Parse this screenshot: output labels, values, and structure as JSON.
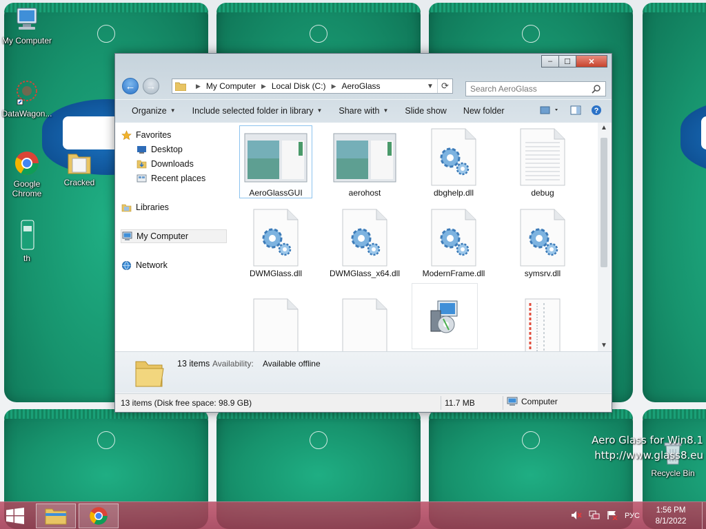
{
  "desktop": {
    "icons": [
      {
        "label": "My Computer"
      },
      {
        "label": "DataWagon..."
      },
      {
        "label": "Google Chrome"
      },
      {
        "label": "Cracked"
      },
      {
        "label": "th"
      },
      {
        "label": "Recycle Bin"
      }
    ],
    "watermark": {
      "line1": "Aero Glass for Win8.1",
      "line2": "http://www.glass8.eu"
    }
  },
  "window": {
    "address": {
      "crumbs": [
        "My Computer",
        "Local Disk (C:)",
        "AeroGlass"
      ]
    },
    "search": {
      "placeholder": "Search AeroGlass"
    },
    "commands": {
      "organize": "Organize",
      "include": "Include selected folder in library",
      "share": "Share with",
      "slideshow": "Slide show",
      "newfolder": "New folder"
    },
    "nav": {
      "favorites": "Favorites",
      "desktop": "Desktop",
      "downloads": "Downloads",
      "recent": "Recent places",
      "libraries": "Libraries",
      "computer": "My Computer",
      "network": "Network"
    },
    "files": [
      {
        "name": "AeroGlassGUI",
        "kind": "app-window"
      },
      {
        "name": "aerohost",
        "kind": "app-window"
      },
      {
        "name": "dbghelp.dll",
        "kind": "gear-doc"
      },
      {
        "name": "debug",
        "kind": "text-doc"
      },
      {
        "name": "DWMGlass.dll",
        "kind": "gear-doc"
      },
      {
        "name": "DWMGlass_x64.dll",
        "kind": "gear-doc"
      },
      {
        "name": "ModernFrame.dll",
        "kind": "gear-doc"
      },
      {
        "name": "symsrv.dll",
        "kind": "gear-doc"
      },
      {
        "name": "",
        "kind": "blank-doc"
      },
      {
        "name": "",
        "kind": "blank-doc"
      },
      {
        "name": "",
        "kind": "installer"
      },
      {
        "name": "",
        "kind": "striped-doc"
      }
    ],
    "details": {
      "count": "13 items",
      "availability_label": "Availability:",
      "availability_value": "Available offline"
    },
    "status": {
      "left": "13 items (Disk free space: 98.9 GB)",
      "size": "11.7 MB",
      "location": "Computer"
    }
  },
  "taskbar": {
    "lang": "РУС",
    "time": "1:56 PM",
    "date": "8/1/2022"
  },
  "colors": {
    "accent": "#2b72c7",
    "taskbar": "#b4465f",
    "wallpaper_green": "#17936d"
  }
}
